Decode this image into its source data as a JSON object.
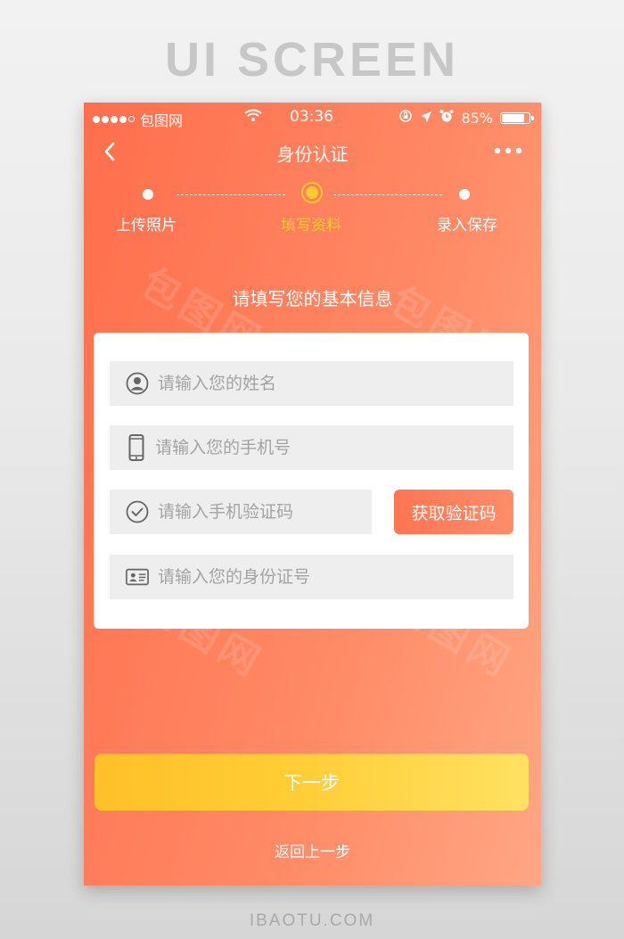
{
  "frame": {
    "title": "UI SCREEN",
    "footer": "IBAOTU.COM"
  },
  "status_bar": {
    "carrier": "包图网",
    "time": "03:36",
    "battery_text": "85%",
    "battery_level": 0.85
  },
  "header": {
    "title": "身份认证",
    "back_icon": "chevron-left-icon",
    "more_icon": "more-dots-icon"
  },
  "steps": [
    {
      "label": "上传照片",
      "active": false
    },
    {
      "label": "填写资料",
      "active": true
    },
    {
      "label": "录入保存",
      "active": false
    }
  ],
  "form": {
    "title": "请填写您的基本信息",
    "fields": [
      {
        "icon": "user-icon",
        "placeholder": "请输入您的姓名",
        "value": ""
      },
      {
        "icon": "phone-icon",
        "placeholder": "请输入您的手机号",
        "value": ""
      },
      {
        "icon": "check-circle-icon",
        "placeholder": "请输入手机验证码",
        "value": ""
      },
      {
        "icon": "id-card-icon",
        "placeholder": "请输入您的身份证号",
        "value": ""
      }
    ],
    "code_button": "获取验证码"
  },
  "actions": {
    "next": "下一步",
    "back": "返回上一步"
  },
  "colors": {
    "accent": "#ff7552",
    "active_step": "#ffcb2e",
    "primary_button": "#ffc72e"
  }
}
